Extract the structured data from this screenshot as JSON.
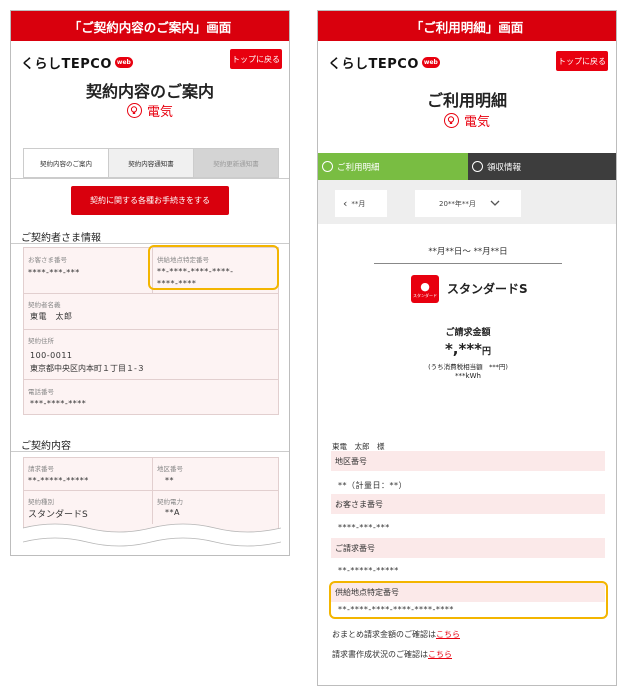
{
  "left": {
    "caption": "「ご契約内容のご案内」画面",
    "logo": "くらしTEPCO",
    "logo_badge": "web",
    "top_button": "トップに戻る",
    "page_title": "契約内容のご案内",
    "service": "電気",
    "tabs": [
      {
        "label": "契約内容のご案内",
        "state": "active"
      },
      {
        "label": "契約内容通知書",
        "state": "normal"
      },
      {
        "label": "契約更新通知書",
        "state": "disabled"
      }
    ],
    "action_button": "契約に関する各種お手続きをする",
    "contractor_section": "ご契約者さま情報",
    "fields": {
      "customer_no_label": "お客さま番号",
      "customer_no_value": "****-***-***",
      "supply_point_label": "供給地点特定番号",
      "supply_point_value_1": "**-****-****-****-",
      "supply_point_value_2": "****-****",
      "name_label": "契約者名義",
      "name_value": "東電　太郎",
      "address_label": "契約住所",
      "postal_code": "100-0011",
      "address": "東京都中央区内本町１丁目１-３",
      "phone_label": "電話番号",
      "phone_value": "***-****-****"
    },
    "contract_section": "ご契約内容",
    "contract": {
      "billing_no_label": "請求番号",
      "billing_no_value": "**-*****-*****",
      "area_label": "地区番号",
      "area_value": "**",
      "type_label": "契約種別",
      "type_value": "スタンダードS",
      "power_label": "契約電力",
      "power_value": "**A"
    }
  },
  "right": {
    "caption": "「ご利用明細」画面",
    "logo": "くらしTEPCO",
    "logo_badge": "web",
    "top_button": "トップに戻る",
    "page_title": "ご利用明細",
    "service": "電気",
    "tabs": [
      "ご利用明細",
      "領収情報"
    ],
    "prev_month": "**月",
    "month_select": "20**年**月",
    "period": "**月**日～ **月**日",
    "plan_icon_text": "スタンダード",
    "plan_name": "スタンダードS",
    "billing_amount_label": "ご請求金額",
    "billing_amount_value": "*,***",
    "yen": "円",
    "tax_note": "(うち消費税相当額　***円)",
    "usage": "***kWh",
    "customer_name": "東電　太郎　様",
    "area_label": "地区番号",
    "area_value": "**（計量日：**）",
    "customer_no_label": "お客さま番号",
    "customer_no_value": "****-***-***",
    "billing_no_label": "ご請求番号",
    "billing_no_value": "**-*****-*****",
    "supply_point_label": "供給地点特定番号",
    "supply_point_value": "**-****-****-****-****-****",
    "summary_text": "おまとめ請求金額のご確認は",
    "summary_link": "こちら",
    "status_text": "請求書作成状況のご確認は",
    "status_link": "こちら"
  },
  "colors": {
    "brand_red": "#e8000f",
    "caption_red": "#d9000d",
    "highlight": "#f3b500",
    "tab_green": "#79bd42",
    "tab_dark": "#3d3d3d",
    "card_pink": "#fdf3f3"
  }
}
